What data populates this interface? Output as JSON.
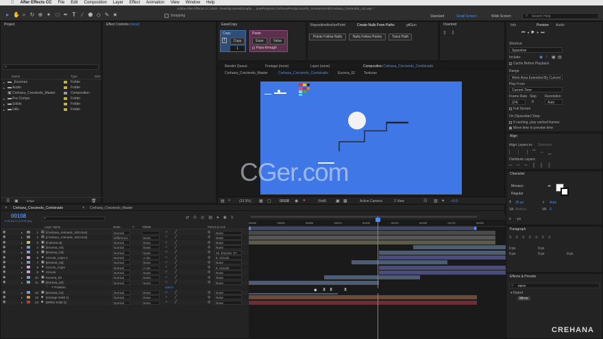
{
  "menubar": {
    "app": "After Effects CC",
    "items": [
      "File",
      "Edit",
      "Composition",
      "Layer",
      "Effect",
      "Animation",
      "View",
      "Window",
      "Help"
    ]
  },
  "toolbar": {
    "snapping_label": "Snapping",
    "path": "Adobe After Effects CC 2018 - /Users/jrcanesi/Dropbo ... ana/Proyecto Crehana/Produccion/03_Animacion/AE/Crehana_Creciendo_v11.aep *",
    "workspaces": [
      "Standard",
      "Small Screen",
      "Wide Screen"
    ],
    "active_workspace": "Small Screen",
    "search_placeholder": "Search Help"
  },
  "project": {
    "title": "Project",
    "effect_controls": "Effect Controls",
    "effect_controls_target": "(none)",
    "columns": [
      "Name",
      "Type",
      "Size"
    ],
    "items": [
      {
        "name": "_Escenas",
        "type": "Folder",
        "color": "#c2b52a"
      },
      {
        "name": "Audio",
        "type": "Folder",
        "color": "#c2b52a"
      },
      {
        "name": "Crehana_Creciendo_Master",
        "type": "Composition",
        "color": "#9a9a9a"
      },
      {
        "name": "Pre-Comps",
        "type": "Folder",
        "color": "#c2b52a"
      },
      {
        "name": "Solids",
        "type": "Folder",
        "color": "#c2b52a"
      },
      {
        "name": "Utils",
        "type": "Folder",
        "color": "#c2b52a"
      }
    ],
    "bpc": "8 bpc"
  },
  "easecopy": {
    "title": "EaseCopy",
    "copy_label": "Copy",
    "copy_btn": "Copy",
    "copy_value": "1",
    "paste_label": "Paste",
    "ease_btn": "Ease",
    "value_btn": "Value",
    "pass_through": "Pass-through"
  },
  "scripts": {
    "tabs": [
      "RepositionAnchorPoint",
      "Create Nulls From Paths",
      "gifGun"
    ],
    "buttons": [
      "Points Follow Nulls",
      "Nulls Follow Points",
      "Trace Path"
    ],
    "overlord": "Overlord"
  },
  "viewer": {
    "tabs": [
      "Render Queue",
      "Footage (none)",
      "Layer (none)",
      "Composition"
    ],
    "comp_name": "Crehana_Creciendo_Combinado",
    "flow": [
      "Crehana_Creciendo_Master",
      "Crehana_Creciendo_Combinado",
      "Escena_02",
      "Texturas"
    ],
    "zoom": "(33.3%)",
    "timecode": "00108",
    "quality": "(Half)",
    "camera": "Active Camera",
    "views": "1 View",
    "exposure": "+0.0",
    "watermark": "CGer.com",
    "bg_color": "#3f78e6"
  },
  "right": {
    "tabs": [
      "Info",
      "Preview",
      "Audio"
    ],
    "shortcut_label": "Shortcut",
    "shortcut_value": "Spacebar",
    "include_label": "Include:",
    "cache_before": "Cache Before Playback",
    "range_label": "Range",
    "range_value": "Work Area Extended By Current T...",
    "play_from_label": "Play From",
    "play_from_value": "Current Time",
    "frame_rate_label": "Frame Rate",
    "skip_label": "Skip",
    "resolution_label": "Resolution",
    "frame_rate_value": "(24)",
    "skip_value": "0",
    "resolution_value": "Auto",
    "full_screen": "Full Screen",
    "on_spacebar": "On (Spacebar) Stop:",
    "if_caching": "If caching, play cached frames",
    "move_time": "Move time to preview time",
    "align_title": "Align",
    "align_layers_to": "Align Layers to:",
    "align_target": "Selection",
    "distribute": "Distribute Layers:",
    "character_title": "Character",
    "font": "Monaco",
    "style": "Regular",
    "size": "25 px",
    "leading": "Auto",
    "tracking_label": "Metrics",
    "tracking": "0",
    "stroke": "- px",
    "paragraph_title": "Paragraph",
    "para_values": [
      "0 px",
      "0 px",
      "0 px",
      "0 px",
      "0 px"
    ],
    "effects_title": "Effects & Presets",
    "effects_search": "mirro",
    "distort": "Distort",
    "mirror": "Mirror",
    "brand": "CREHANA"
  },
  "timeline": {
    "tabs": [
      "Crehana_Creciendo_Combinado",
      "Crehana_Creciendo_Master"
    ],
    "timecode": "00108",
    "timecode_sub": "0:00:04:12 (24.00 fps)",
    "columns": [
      "Layer Name",
      "Mode",
      "T",
      "TrkMat",
      "Parent & Link"
    ],
    "ruler": [
      "00000",
      "00025",
      "00050",
      "00075",
      "00100",
      "00125",
      "00150",
      "00175",
      "00200"
    ],
    "layers": [
      {
        "num": "1",
        "name": "[Crehana_Animatic_v02.mov]",
        "mode": "Normal",
        "trk": "",
        "parent": "None",
        "icon": "film"
      },
      {
        "num": "2",
        "name": "[Crehana_Animatic_v02.mov]",
        "mode": "Difference",
        "trk": "None",
        "parent": "None",
        "icon": "film"
      },
      {
        "num": "3",
        "name": "[Colores.ai]",
        "mode": "Normal",
        "trk": "None",
        "parent": "None",
        "icon": "ai"
      },
      {
        "num": "4",
        "name": "[Escena_04]",
        "mode": "Normal",
        "trk": "None",
        "parent": "None",
        "icon": "comp"
      },
      {
        "num": "5",
        "name": "[Escena_03]",
        "mode": "Normal",
        "trk": "None",
        "parent": "10. Escena_0?",
        "icon": "comp"
      },
      {
        "num": "6",
        "name": "Circulo_copia 2",
        "mode": "Normal",
        "trk": "A.Inv",
        "parent": "9. Circulo",
        "icon": "star"
      },
      {
        "num": "7",
        "name": "[Escena_03]",
        "mode": "Normal",
        "trk": "None",
        "parent": "None",
        "icon": "comp"
      },
      {
        "num": "8",
        "name": "Circulo_copia",
        "mode": "Normal",
        "trk": "A.Inv",
        "parent": "9. Circulo",
        "icon": "star"
      },
      {
        "num": "9",
        "name": "Circulo",
        "mode": "Normal",
        "trk": "None",
        "parent": "None",
        "icon": "star"
      },
      {
        "num": "10",
        "name": "Escena_03",
        "mode": "Normal",
        "trk": "None",
        "parent": "None",
        "icon": "comp"
      },
      {
        "num": "11",
        "name": "[Escena_02]",
        "mode": "Normal",
        "trk": "None",
        "parent": "None",
        "icon": "comp"
      },
      {
        "num": "",
        "name": "Y Position",
        "mode": "",
        "trk": "",
        "parent": "",
        "icon": "prop",
        "value": "540.0"
      },
      {
        "num": "13",
        "name": "[Escena_01]",
        "mode": "Normal",
        "trk": "None",
        "parent": "None",
        "icon": "comp"
      },
      {
        "num": "13",
        "name": "[Orange Solid 1]",
        "mode": "Normal",
        "trk": "None",
        "parent": "None",
        "icon": "solid"
      },
      {
        "num": "14",
        "name": "[White Solid 2]",
        "mode": "Normal",
        "trk": "None",
        "parent": "None",
        "icon": "solid"
      }
    ],
    "label_colors": [
      "#7b7b7b",
      "#7b7b7b",
      "#c9c26b",
      "#7aa0c9",
      "#7aa0c9",
      "#c9a0c9",
      "#7aa0c9",
      "#c9a0c9",
      "#c9a0c9",
      "#7aa0c9",
      "#7aa0c9",
      "#7aa0c9",
      "#7aa0c9",
      "#d68a3c",
      "#c23a3a"
    ]
  }
}
